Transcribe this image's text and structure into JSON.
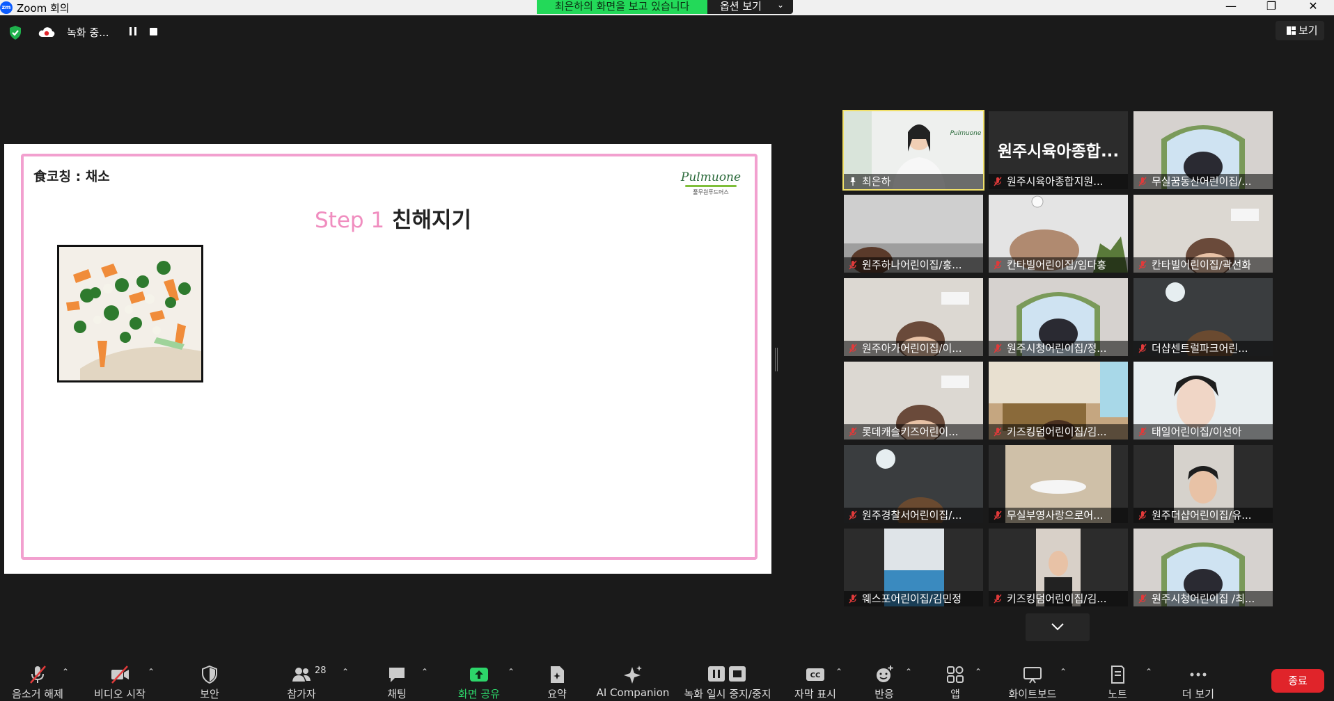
{
  "window": {
    "title": "Zoom 회의",
    "app_icon_text": "zm"
  },
  "share_banner": {
    "text": "최은하의 화면을 보고 있습니다",
    "options_label": "옵션 보기"
  },
  "recording": {
    "status_text": "녹화 중..."
  },
  "view_button": {
    "label": "보기"
  },
  "shared_slide": {
    "topic": "食코칭 : 채소",
    "step_num": "Step 1",
    "step_title": "친해지기",
    "brand_name": "Pulmuone",
    "brand_sub": "풀무원푸드머스"
  },
  "gallery": [
    {
      "name": "최은하",
      "muted": false,
      "active": true,
      "scene": "presenter"
    },
    {
      "name": "원주시육아종합지원...",
      "muted": true,
      "active": false,
      "big_name": "원주시육아종합...",
      "scene": "none"
    },
    {
      "name": "무실꿈동산어린이집/...",
      "muted": true,
      "active": false,
      "scene": "window"
    },
    {
      "name": "원주하나어린이집/홍...",
      "muted": true,
      "active": false,
      "scene": "ceiling"
    },
    {
      "name": "칸타빌어린이집/임다홍",
      "muted": true,
      "active": false,
      "scene": "ceiling2"
    },
    {
      "name": "칸타빌어린이집/곽선화",
      "muted": true,
      "active": false,
      "scene": "room"
    },
    {
      "name": "원주아가어린이집/이...",
      "muted": true,
      "active": false,
      "scene": "room"
    },
    {
      "name": "원주시청어린이집/정...",
      "muted": true,
      "active": false,
      "scene": "window"
    },
    {
      "name": "더샵센트럴파크어린...",
      "muted": true,
      "active": false,
      "scene": "dark"
    },
    {
      "name": "롯데캐슬키즈어린이...",
      "muted": true,
      "active": false,
      "scene": "room"
    },
    {
      "name": "키즈킹덤어린이집/김...",
      "muted": true,
      "active": false,
      "scene": "shelves"
    },
    {
      "name": "태일어린이집/이선아",
      "muted": true,
      "active": false,
      "scene": "face"
    },
    {
      "name": "원주경찰서어린이집/...",
      "muted": true,
      "active": false,
      "scene": "dark"
    },
    {
      "name": "무실부영사랑으로어...",
      "muted": true,
      "active": false,
      "scene": "narrow"
    },
    {
      "name": "원주더샵어린이집/유...",
      "muted": true,
      "active": false,
      "scene": "narrow2"
    },
    {
      "name": "웨스포어린이집/김민정",
      "muted": true,
      "active": false,
      "scene": "narrow3"
    },
    {
      "name": "키즈킹덤어린이집/김...",
      "muted": true,
      "active": false,
      "scene": "narrow4"
    },
    {
      "name": "원주시청어린이집 /최...",
      "muted": true,
      "active": false,
      "scene": "window"
    }
  ],
  "toolbar": {
    "mute_label": "음소거 해제",
    "video_label": "비디오 시작",
    "security_label": "보안",
    "participants_label": "참가자",
    "participants_count": "28",
    "chat_label": "채팅",
    "share_label": "화면 공유",
    "summary_label": "요약",
    "ai_label": "AI Companion",
    "record_label": "녹화 일시 중지/중지",
    "captions_label": "자막 표시",
    "reactions_label": "반응",
    "apps_label": "앱",
    "whiteboard_label": "화이트보드",
    "notes_label": "노트",
    "more_label": "더 보기",
    "end_label": "종료"
  },
  "colors": {
    "share_green": "#23d959",
    "end_red": "#e0242a",
    "slide_pink": "#f2a0cf",
    "active_speaker": "#f0e06a",
    "muted_red": "#e03a3a"
  }
}
